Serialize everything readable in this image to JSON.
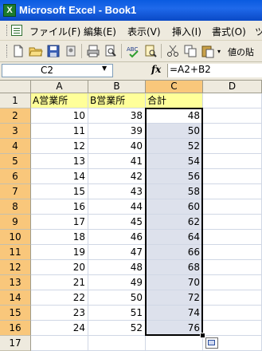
{
  "window": {
    "title": "Microsoft Excel - Book1",
    "app_icon": "excel-icon"
  },
  "menu": {
    "items": [
      {
        "label": "ファイル(F)"
      },
      {
        "label": "編集(E)"
      },
      {
        "label": "表示(V)"
      },
      {
        "label": "挿入(I)"
      },
      {
        "label": "書式(O)"
      },
      {
        "label": "ツ"
      }
    ]
  },
  "toolbar": {
    "buttons": [
      "new-icon",
      "open-icon",
      "save-icon",
      "permission-icon",
      "print-icon",
      "print-preview-icon",
      "spelling-icon",
      "research-icon",
      "cut-icon",
      "copy-icon",
      "paste-icon"
    ],
    "paste_values_label": "値の貼"
  },
  "formula_bar": {
    "name_box": "C2",
    "fx_label": "fx",
    "formula": "=A2+B2"
  },
  "columns": [
    "A",
    "B",
    "C",
    "D"
  ],
  "rows": [
    {
      "num": "1",
      "a": "A営業所",
      "b": "B営業所",
      "c": "合計"
    },
    {
      "num": "2",
      "a": "10",
      "b": "38",
      "c": "48"
    },
    {
      "num": "3",
      "a": "11",
      "b": "39",
      "c": "50"
    },
    {
      "num": "4",
      "a": "12",
      "b": "40",
      "c": "52"
    },
    {
      "num": "5",
      "a": "13",
      "b": "41",
      "c": "54"
    },
    {
      "num": "6",
      "a": "14",
      "b": "42",
      "c": "56"
    },
    {
      "num": "7",
      "a": "15",
      "b": "43",
      "c": "58"
    },
    {
      "num": "8",
      "a": "16",
      "b": "44",
      "c": "60"
    },
    {
      "num": "9",
      "a": "17",
      "b": "45",
      "c": "62"
    },
    {
      "num": "10",
      "a": "18",
      "b": "46",
      "c": "64"
    },
    {
      "num": "11",
      "a": "19",
      "b": "47",
      "c": "66"
    },
    {
      "num": "12",
      "a": "20",
      "b": "48",
      "c": "68"
    },
    {
      "num": "13",
      "a": "21",
      "b": "49",
      "c": "70"
    },
    {
      "num": "14",
      "a": "22",
      "b": "50",
      "c": "72"
    },
    {
      "num": "15",
      "a": "23",
      "b": "51",
      "c": "74"
    },
    {
      "num": "16",
      "a": "24",
      "b": "52",
      "c": "76"
    },
    {
      "num": "17",
      "a": "",
      "b": "",
      "c": ""
    }
  ],
  "colors": {
    "selection_header": "#f9c77b",
    "header_fill": "#ffff99",
    "selected_cells": "#dde1ec",
    "title_bar": "#0a5be0"
  }
}
